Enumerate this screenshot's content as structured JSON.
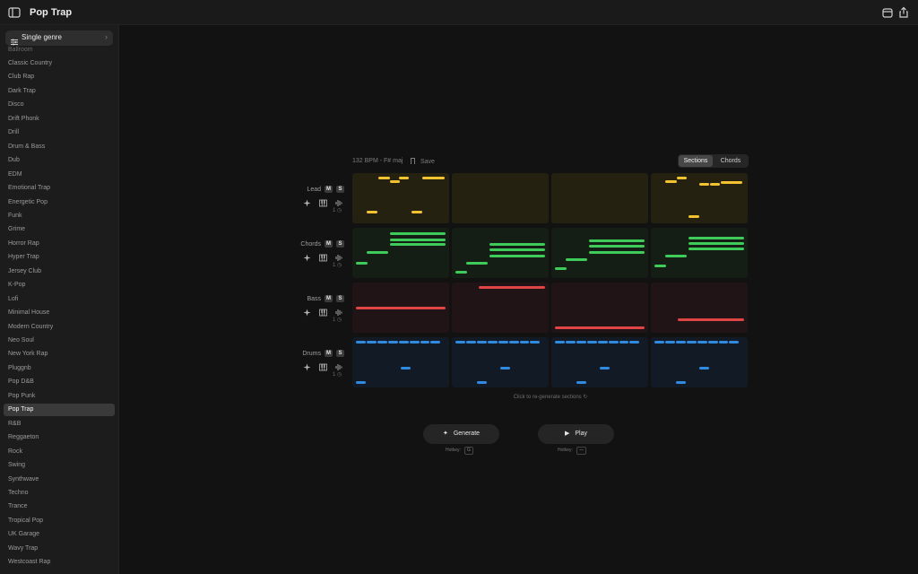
{
  "app": {
    "title": "Pop Trap"
  },
  "sidebar": {
    "genre_select_label": "Single genre",
    "cut_item": "Ballroom",
    "genres": [
      "Classic Country",
      "Club Rap",
      "Dark Trap",
      "Disco",
      "Drift Phonk",
      "Drill",
      "Drum & Bass",
      "Dub",
      "EDM",
      "Emotional Trap",
      "Energetic Pop",
      "Funk",
      "Grime",
      "Horror Rap",
      "Hyper Trap",
      "Jersey Club",
      "K-Pop",
      "Lofi",
      "Minimal House",
      "Modern Country",
      "Neo Soul",
      "New York Rap",
      "Pluggnb",
      "Pop D&B",
      "Pop Punk",
      "Pop Trap",
      "R&B",
      "Reggaeton",
      "Rock",
      "Swing",
      "Synthwave",
      "Techno",
      "Trance",
      "Tropical Pop",
      "UK Garage",
      "Wavy Trap",
      "Westcoast Rap"
    ],
    "active_genre": "Pop Trap"
  },
  "main": {
    "info": "132 BPM - F# maj",
    "save_label": "Save",
    "tabs": [
      {
        "label": "Sections",
        "active": true
      },
      {
        "label": "Chords",
        "active": false
      }
    ],
    "regen_hint": "Click to re-generate sections",
    "generate_label": "Generate",
    "play_label": "Play",
    "hotkey_label": "Hotkey:",
    "generate_hotkey": "G",
    "play_hotkey": "—"
  },
  "tracks": [
    {
      "name": "Lead",
      "mute": "M",
      "solo": "S",
      "count": "1",
      "color": "#f2c230",
      "bg": "#252111",
      "sections": [
        [
          [
            0.27,
            0.07,
            0.12
          ],
          [
            0.39,
            0.15,
            0.1
          ],
          [
            0.48,
            0.07,
            0.1
          ],
          [
            0.72,
            0.07,
            0.23
          ],
          [
            0.15,
            0.75,
            0.11
          ],
          [
            0.61,
            0.75,
            0.11
          ]
        ],
        [],
        [],
        [
          [
            0.15,
            0.15,
            0.12
          ],
          [
            0.27,
            0.07,
            0.1
          ],
          [
            0.5,
            0.19,
            0.1
          ],
          [
            0.61,
            0.19,
            0.1
          ],
          [
            0.72,
            0.16,
            0.22
          ],
          [
            0.39,
            0.84,
            0.11
          ]
        ]
      ]
    },
    {
      "name": "Chords",
      "mute": "M",
      "solo": "S",
      "count": "1",
      "color": "#3fcb5a",
      "bg": "#141e14",
      "sections": [
        [
          [
            0.39,
            0.09,
            0.57
          ],
          [
            0.39,
            0.21,
            0.57
          ],
          [
            0.39,
            0.31,
            0.57
          ],
          [
            0.15,
            0.46,
            0.22
          ],
          [
            0.04,
            0.67,
            0.12
          ]
        ],
        [
          [
            0.39,
            0.31,
            0.57
          ],
          [
            0.39,
            0.41,
            0.57
          ],
          [
            0.39,
            0.54,
            0.57
          ],
          [
            0.15,
            0.67,
            0.22
          ],
          [
            0.04,
            0.85,
            0.12
          ]
        ],
        [
          [
            0.39,
            0.23,
            0.57
          ],
          [
            0.39,
            0.34,
            0.57
          ],
          [
            0.39,
            0.46,
            0.57
          ],
          [
            0.15,
            0.61,
            0.22
          ],
          [
            0.04,
            0.79,
            0.12
          ]
        ],
        [
          [
            0.39,
            0.17,
            0.57
          ],
          [
            0.39,
            0.28,
            0.57
          ],
          [
            0.39,
            0.39,
            0.57
          ],
          [
            0.15,
            0.54,
            0.22
          ],
          [
            0.04,
            0.74,
            0.12
          ]
        ]
      ]
    },
    {
      "name": "Bass",
      "mute": "M",
      "solo": "S",
      "count": "1",
      "color": "#e04545",
      "bg": "#201416",
      "sections": [
        [
          [
            0.04,
            0.49,
            0.92
          ]
        ],
        [
          [
            0.28,
            0.08,
            0.68
          ]
        ],
        [
          [
            0.04,
            0.88,
            0.92
          ]
        ],
        [
          [
            0.28,
            0.71,
            0.68
          ]
        ]
      ]
    },
    {
      "name": "Drums",
      "mute": "M",
      "solo": "S",
      "count": "1",
      "color": "#2f8ae0",
      "bg": "#121a26",
      "sections": [
        [
          [
            0.04,
            0.08,
            0.1
          ],
          [
            0.15,
            0.08,
            0.1
          ],
          [
            0.26,
            0.08,
            0.1
          ],
          [
            0.37,
            0.08,
            0.1
          ],
          [
            0.48,
            0.08,
            0.1
          ],
          [
            0.59,
            0.08,
            0.1
          ],
          [
            0.7,
            0.08,
            0.1
          ],
          [
            0.81,
            0.08,
            0.1
          ],
          [
            0.5,
            0.59,
            0.1
          ],
          [
            0.04,
            0.88,
            0.1
          ]
        ],
        [
          [
            0.04,
            0.08,
            0.1
          ],
          [
            0.15,
            0.08,
            0.1
          ],
          [
            0.26,
            0.08,
            0.1
          ],
          [
            0.37,
            0.08,
            0.1
          ],
          [
            0.48,
            0.08,
            0.1
          ],
          [
            0.59,
            0.08,
            0.1
          ],
          [
            0.7,
            0.08,
            0.1
          ],
          [
            0.81,
            0.08,
            0.1
          ],
          [
            0.5,
            0.59,
            0.1
          ],
          [
            0.26,
            0.88,
            0.1
          ]
        ],
        [
          [
            0.04,
            0.08,
            0.1
          ],
          [
            0.15,
            0.08,
            0.1
          ],
          [
            0.26,
            0.08,
            0.1
          ],
          [
            0.37,
            0.08,
            0.1
          ],
          [
            0.48,
            0.08,
            0.1
          ],
          [
            0.59,
            0.08,
            0.1
          ],
          [
            0.7,
            0.08,
            0.1
          ],
          [
            0.81,
            0.08,
            0.1
          ],
          [
            0.5,
            0.59,
            0.1
          ],
          [
            0.26,
            0.88,
            0.1
          ]
        ],
        [
          [
            0.04,
            0.08,
            0.1
          ],
          [
            0.15,
            0.08,
            0.1
          ],
          [
            0.26,
            0.08,
            0.1
          ],
          [
            0.37,
            0.08,
            0.1
          ],
          [
            0.48,
            0.08,
            0.1
          ],
          [
            0.59,
            0.08,
            0.1
          ],
          [
            0.7,
            0.08,
            0.1
          ],
          [
            0.81,
            0.08,
            0.1
          ],
          [
            0.5,
            0.59,
            0.1
          ],
          [
            0.26,
            0.88,
            0.1
          ]
        ]
      ]
    }
  ]
}
